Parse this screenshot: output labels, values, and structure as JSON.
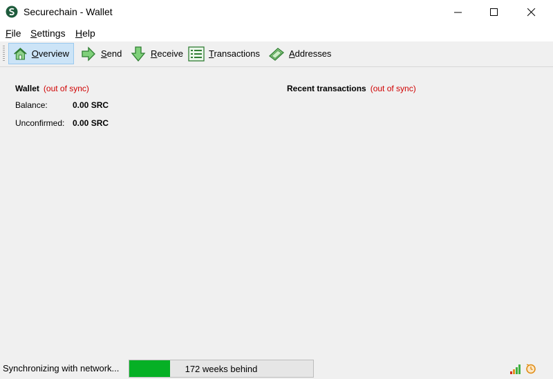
{
  "window": {
    "title": "Securechain - Wallet"
  },
  "menu": {
    "items": [
      {
        "key": "F",
        "rest": "ile"
      },
      {
        "key": "S",
        "rest": "ettings"
      },
      {
        "key": "H",
        "rest": "elp"
      }
    ]
  },
  "toolbar": {
    "items": [
      {
        "key": "O",
        "rest": "verview",
        "icon": "home-icon",
        "active": true
      },
      {
        "key": "S",
        "rest": "end",
        "icon": "send-arrow-icon",
        "active": false
      },
      {
        "key": "R",
        "rest": "eceive",
        "icon": "receive-arrow-icon",
        "active": false
      },
      {
        "key": "T",
        "rest": "ransactions",
        "icon": "transactions-list-icon",
        "active": false
      },
      {
        "key": "A",
        "rest": "ddresses",
        "icon": "address-book-icon",
        "active": false
      }
    ]
  },
  "wallet": {
    "title": "Wallet",
    "sync_status": "(out of sync)",
    "balance_label": "Balance:",
    "balance_value": "0.00 SRC",
    "unconfirmed_label": "Unconfirmed:",
    "unconfirmed_value": "0.00 SRC"
  },
  "recent": {
    "title": "Recent transactions",
    "sync_status": "(out of sync)"
  },
  "status": {
    "text": "Synchronizing with network...",
    "progress_text": "172 weeks behind",
    "progress_fraction": 0.22,
    "icons": [
      "connection-signal-icon",
      "sync-clock-icon"
    ]
  },
  "colors": {
    "accent": "#06b025",
    "warning": "#d00000",
    "active_tab": "#cce4f7"
  }
}
